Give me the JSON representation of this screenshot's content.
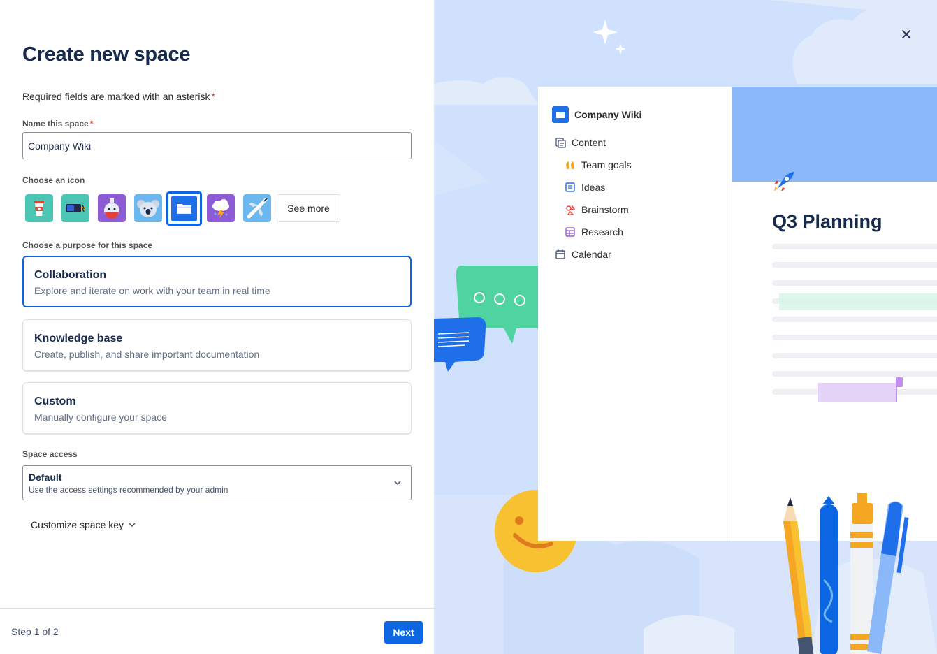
{
  "form": {
    "title": "Create new space",
    "required_note": "Required fields are marked with an asterisk",
    "asterisk": "*",
    "name_label": "Name this space",
    "name_value": "Company Wiki",
    "icon_label": "Choose an icon",
    "icons": [
      "coffee-cup-icon",
      "battery-icon",
      "potion-icon",
      "koala-icon",
      "folder-icon",
      "storm-cloud-icon",
      "airplane-icon"
    ],
    "selected_icon": "folder-icon",
    "see_more_label": "See more",
    "purpose_label": "Choose a purpose for this space",
    "purposes": [
      {
        "title": "Collaboration",
        "description": "Explore and iterate on work with your team in real time",
        "selected": true
      },
      {
        "title": "Knowledge base",
        "description": "Create, publish, and share important documentation",
        "selected": false
      },
      {
        "title": "Custom",
        "description": "Manually configure your space",
        "selected": false
      }
    ],
    "access_label": "Space access",
    "access_value": "Default",
    "access_description": "Use the access settings recommended by your admin",
    "customize_key_label": "Customize space key"
  },
  "footer": {
    "step_text": "Step 1 of 2",
    "next_label": "Next"
  },
  "preview": {
    "space_name": "Company Wiki",
    "nav": [
      {
        "label": "Content",
        "icon": "pages-icon"
      },
      {
        "label": "Team goals",
        "icon": "raised-hands-icon"
      },
      {
        "label": "Ideas",
        "icon": "page-icon"
      },
      {
        "label": "Brainstorm",
        "icon": "whiteboard-icon"
      },
      {
        "label": "Research",
        "icon": "database-icon"
      },
      {
        "label": "Calendar",
        "icon": "calendar-icon"
      }
    ],
    "page_title": "Q3 Planning"
  },
  "colors": {
    "primary": "#0c66e4",
    "background_blue": "#cfe1fd",
    "danger": "#c9372c"
  }
}
